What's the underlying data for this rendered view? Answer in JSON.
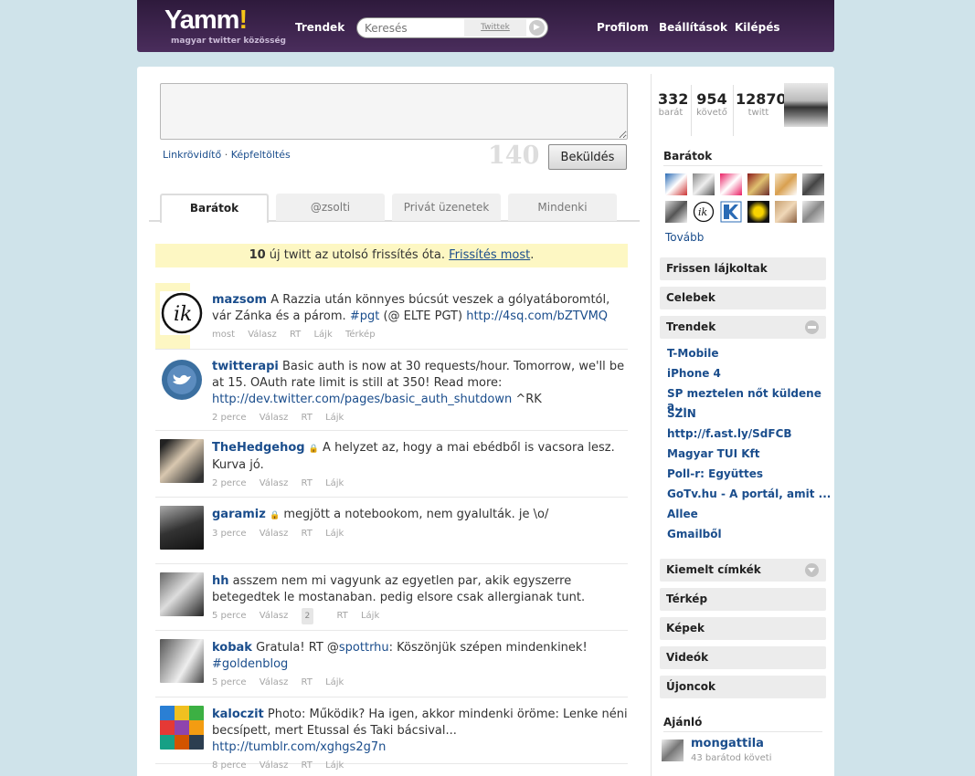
{
  "header": {
    "logo_text": "Yamm",
    "logo_bang": "!",
    "logo_sub": "magyar twitter közösség",
    "nav_trends": "Trendek",
    "search_placeholder": "Keresés",
    "search_scope": "Twittek",
    "nav_profile": "Profilom",
    "nav_settings": "Beállítások",
    "nav_logout": "Kilépés"
  },
  "compose": {
    "link_shorten": "Linkrövidítő",
    "separator": "·",
    "image_upload": "Képfeltöltés",
    "counter": "140",
    "send_label": "Beküldés"
  },
  "tabs": [
    "Barátok",
    "@zsolti",
    "Privát üzenetek",
    "Mindenki"
  ],
  "notice": {
    "count": "10",
    "text": " új twitt az utolsó frissítés óta. ",
    "link": "Frissítés most",
    "end": "."
  },
  "tweets": [
    {
      "user": "mazsom",
      "locked": false,
      "text": " A Razzia után könnyes búcsút veszek a gólyatáboromtól, vár Zánka és a párom. ",
      "tag": "#pgt",
      "text2": " (@ ELTE PGT) ",
      "link": "http://4sq.com/bZTVMQ",
      "text3": "",
      "time": "most",
      "actions": [
        "Válasz",
        "RT",
        "Lájk",
        "Térkép"
      ]
    },
    {
      "user": "twitterapi",
      "locked": false,
      "text": " Basic auth is now at 30 requests/hour. Tomorrow, we'll be at 15. OAuth rate limit is still at 350! Read more: ",
      "tag": "",
      "text2": "",
      "link": "http://dev.twitter.com/pages/basic_auth_shutdown",
      "text3": " ^RK",
      "time": "2 perce",
      "actions": [
        "Válasz",
        "RT",
        "Lájk"
      ]
    },
    {
      "user": "TheHedgehog",
      "locked": true,
      "text": " A helyzet az, hogy a mai ebédből is vacsora lesz. Kurva jó.",
      "tag": "",
      "text2": "",
      "link": "",
      "text3": "",
      "time": "2 perce",
      "actions": [
        "Válasz",
        "RT",
        "Lájk"
      ]
    },
    {
      "user": "garamiz",
      "locked": true,
      "text": " megjött a notebookom, nem gyalulták. je \\o/",
      "tag": "",
      "text2": "",
      "link": "",
      "text3": "",
      "time": "3 perce",
      "actions": [
        "Válasz",
        "RT",
        "Lájk"
      ]
    },
    {
      "user": "hh",
      "locked": false,
      "text": " asszem nem mi vagyunk az egyetlen par, akik egyszerre betegedtek le mostanaban. pedig elsore csak allergianak tunt.",
      "tag": "",
      "text2": "",
      "link": "",
      "text3": "",
      "time": "5 perce",
      "actions": [
        "Válasz",
        "RT",
        "Lájk"
      ],
      "reply_count": "2"
    },
    {
      "user": "kobak",
      "locked": false,
      "text": " Gratula! RT @",
      "tag": "spottrhu",
      "text2": ": Köszönjük szépen mindenkinek! ",
      "link": "#goldenblog",
      "text3": "",
      "time": "5 perce",
      "actions": [
        "Válasz",
        "RT",
        "Lájk"
      ]
    },
    {
      "user": "kaloczit",
      "locked": false,
      "text": " Photo: Működik? Ha igen, akkor mindenki öröme: Lenke néni becsípett, mert Etussal és Taki bácsival... ",
      "tag": "",
      "text2": "",
      "link": "http://tumblr.com/xghgs2g7n",
      "text3": "",
      "time": "8 perce",
      "actions": [
        "Válasz",
        "RT",
        "Lájk"
      ]
    }
  ],
  "stats": {
    "friends": "332",
    "friends_label": "barát",
    "followers": "954",
    "followers_label": "követő",
    "tweets": "12870",
    "tweets_label": "twitt"
  },
  "sidebar": {
    "friends_title": "Barátok",
    "more": "Tovább",
    "recent_likes": "Frissen lájkoltak",
    "celebs": "Celebek",
    "trends_title": "Trendek",
    "trends": [
      "T-Mobile",
      "iPhone 4",
      "SP meztelen nőt küldene a...",
      "SZIN",
      "http://f.ast.ly/SdFCB",
      "Magyar TUI Kft",
      "Poll-r: Együttes",
      "GoTv.hu - A portál, amit ...",
      "Allee",
      "Gmailből"
    ],
    "featured_tags": "Kiemelt címkék",
    "map": "Térkép",
    "images": "Képek",
    "videos": "Videók",
    "newcomers": "Újoncok",
    "recommend_title": "Ajánló",
    "recommend_user": "mongattila",
    "recommend_sub": "43 barátod követi"
  },
  "colors": {
    "header_bg": "#3b2249",
    "link": "#1a4d8c",
    "highlight": "#fdf7c3",
    "page_bg": "#cfe3ea"
  }
}
